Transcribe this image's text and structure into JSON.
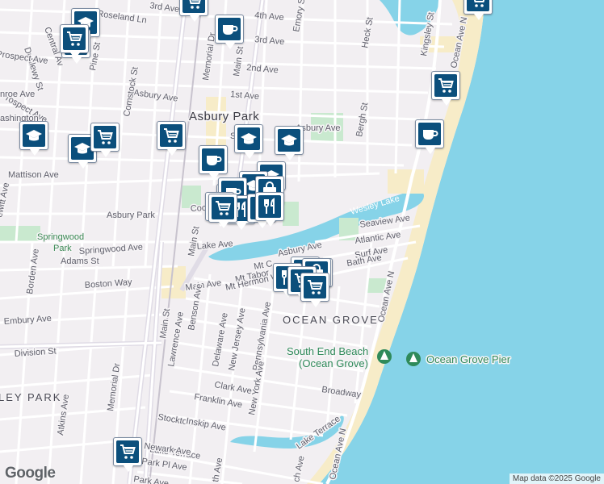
{
  "map": {
    "city_label": "Asbury Park",
    "area_label": "OCEAN GROVE",
    "neighborhood_label": "LEY PARK",
    "lake_label": "Wesley Lake",
    "park_label": "Springwood Park",
    "poi_beach": "South End Beach (Ocean Grove)",
    "poi_beach_line1": "South End Beach",
    "poi_beach_line2": "(Ocean Grove)",
    "poi_pier": "Ocean Grove Pier",
    "attribution": "Map data ©2025 Google",
    "logo": "Google",
    "colors": {
      "water": "#86d3e8",
      "land": "#f2eff2",
      "beach": "#f7ecc8",
      "park": "#c9e9cf",
      "marker": "#0b4f7c"
    }
  },
  "streets": {
    "third_ave": "3rd Ave",
    "fourth_ave": "4th Ave",
    "second_ave": "2nd Ave",
    "first_ave": "1st Ave",
    "roseland": "Roseland Ln",
    "dunlewy": "Dunlewy St",
    "central": "Central Av",
    "pine": "Pine St",
    "emory": "Emory St",
    "heck": "Heck St",
    "kingsley": "Kingsley St",
    "ocean_ave_n_top": "Ocean Ave N",
    "asbury_ave": "Asbury Ave",
    "memorial_dr_top": "Memorial Dr",
    "main_st_top": "Main St",
    "prospect": "Prospect Ave",
    "monroe": "nroe Ave",
    "washington": "ashington",
    "bergh": "Bergh St",
    "comstock": "Comstock St",
    "mattison": "Mattison Ave",
    "dewitt": "ewitt Ave",
    "asbury_park_lbl": "Asbury Park",
    "springwood": "Springwood Ave",
    "lake_ave": "Lake Ave",
    "cookman": "Cookm",
    "main_st": "Main St",
    "adams": "Adams St",
    "borden": "Borden Ave",
    "boston": "Boston Way",
    "asbury_ave2": "Asbury Ave",
    "seaview": "Seaview Ave",
    "atlantic": "Atlantic Ave",
    "surf": "Surf Ave",
    "bath": "Bath Ave",
    "ocean_ave_n": "Ocean Ave N",
    "mt_carmel": "Mt C",
    "mt_tabor": "Mt Tabor",
    "mt_hermon": "Mt Hermon Way",
    "main_ave": "Main Ave",
    "embury": "Embury Ave",
    "division": "Division St",
    "benson": "Benson Ave",
    "lawrence": "Lawrence Ave",
    "delaware": "Delaware Ave",
    "new_jersey": "New Jersey Ave",
    "pennsylvania": "Pennsylvania Ave",
    "main_st2": "Main St",
    "memorial_dr": "Memorial Dr",
    "atkins": "Atkins Ave",
    "clark": "Clark Ave",
    "franklin": "Franklin Ave",
    "stockton": "Stockton Ave",
    "inskip": "Inskip Ave",
    "new_york": "New York Ave",
    "broadway": "Broadway",
    "lake_terrace": "Lake Terrace",
    "lake_terrace2": "Lake Terrace",
    "newark": "Newark Ave",
    "park_pl": "Park Pl Ave",
    "ocean_ave_n2": "Ocean Ave N",
    "park_ave": "Park Ave",
    "spray_ave": "ch Ave",
    "fifth_ave": "th Ave",
    "sewall": "Se",
    "asbury_ave3": "Asbury Ave"
  },
  "markers": [
    {
      "kind": "cart",
      "name": "cart-marker"
    },
    {
      "kind": "school",
      "name": "school-marker"
    },
    {
      "kind": "cart",
      "name": "cart-marker"
    },
    {
      "kind": "cart",
      "name": "cart-marker"
    },
    {
      "kind": "cart",
      "name": "cart-marker"
    },
    {
      "kind": "coffee",
      "name": "coffee-marker"
    },
    {
      "kind": "cart",
      "name": "cart-marker"
    },
    {
      "kind": "school",
      "name": "school-marker"
    },
    {
      "kind": "school",
      "name": "school-marker"
    },
    {
      "kind": "cart",
      "name": "cart-marker"
    },
    {
      "kind": "cart",
      "name": "cart-marker"
    },
    {
      "kind": "school",
      "name": "school-marker"
    },
    {
      "kind": "school",
      "name": "school-marker"
    },
    {
      "kind": "coffee",
      "name": "coffee-marker"
    },
    {
      "kind": "coffee",
      "name": "coffee-marker"
    },
    {
      "kind": "school",
      "name": "school-marker"
    },
    {
      "kind": "cart",
      "name": "cart-marker"
    },
    {
      "kind": "school",
      "name": "school-marker"
    },
    {
      "kind": "coffee",
      "name": "coffee-marker"
    },
    {
      "kind": "cart",
      "name": "cart-marker"
    },
    {
      "kind": "bag",
      "name": "shopping-bag-marker"
    },
    {
      "kind": "restaurant",
      "name": "restaurant-marker"
    },
    {
      "kind": "restaurant",
      "name": "restaurant-marker"
    },
    {
      "kind": "cart",
      "name": "cart-marker"
    },
    {
      "kind": "restaurant",
      "name": "restaurant-marker"
    },
    {
      "kind": "restaurant",
      "name": "restaurant-marker"
    },
    {
      "kind": "cart",
      "name": "cart-marker"
    },
    {
      "kind": "bag",
      "name": "shopping-bag-marker"
    },
    {
      "kind": "restaurant",
      "name": "restaurant-marker"
    },
    {
      "kind": "cart",
      "name": "cart-marker"
    },
    {
      "kind": "cart",
      "name": "cart-marker"
    },
    {
      "kind": "cart",
      "name": "cart-marker"
    }
  ]
}
